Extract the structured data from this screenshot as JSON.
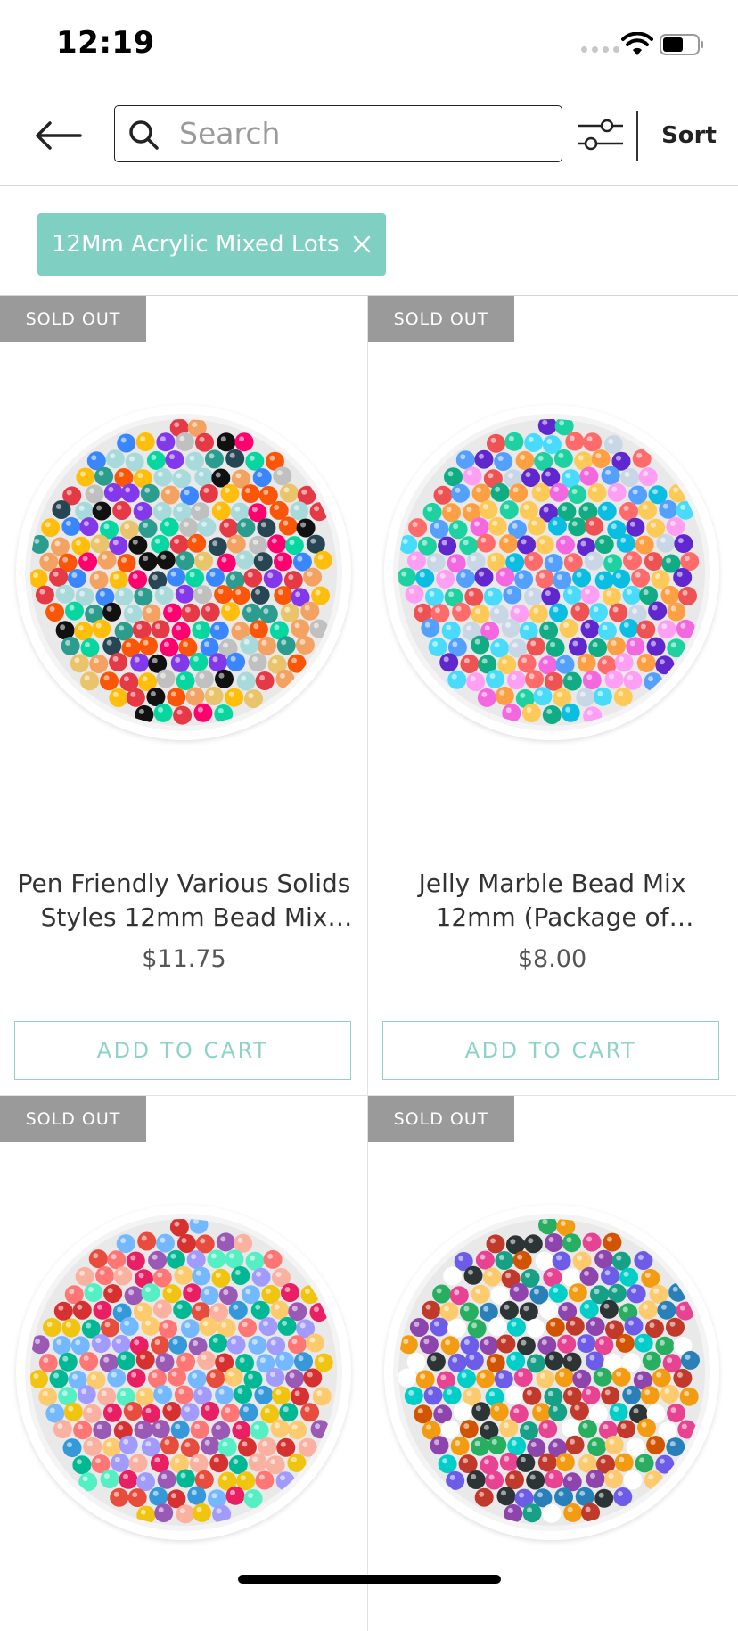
{
  "status_bar": {
    "time": "12:19"
  },
  "header": {
    "search_placeholder": "Search",
    "sort_label": "Sort"
  },
  "active_filters": [
    {
      "label": "12Mm Acrylic Mixed Lots"
    }
  ],
  "products": [
    {
      "badge": "SOLD OUT",
      "title": "Pen Friendly Various Solids Styles 12mm Bead Mix (Package of Approx...",
      "price": "$11.75",
      "cta": "ADD TO CART"
    },
    {
      "badge": "SOLD OUT",
      "title": "Jelly Marble Bead Mix 12mm (Package of Approx...",
      "price": "$8.00",
      "cta": "ADD TO CART"
    },
    {
      "badge": "SOLD OUT"
    },
    {
      "badge": "SOLD OUT"
    }
  ],
  "colors": {
    "accent": "#7fcfc2",
    "badge_bg": "#9a9a9a",
    "bead_palette_1": [
      "#e63946",
      "#f4a261",
      "#2a9d8f",
      "#264653",
      "#e9c46a",
      "#a8dadc",
      "#8338ec",
      "#ff006e",
      "#3a86ff",
      "#fb5607",
      "#c0c0c0",
      "#111111",
      "#06d6a0",
      "#ffbe0b"
    ],
    "bead_palette_2": [
      "#ff6b6b",
      "#feca57",
      "#48dbfb",
      "#ff9ff3",
      "#54a0ff",
      "#5f27cd",
      "#1dd1a1",
      "#ff9f43",
      "#c8d6e5",
      "#ee5253",
      "#0abde3",
      "#10ac84",
      "#f368e0"
    ],
    "bead_palette_3": [
      "#e74c3c",
      "#f1c40f",
      "#3498db",
      "#9b59b6",
      "#e91e63",
      "#ff7675",
      "#fdcb6e",
      "#00b894",
      "#a29bfe",
      "#d63031",
      "#fab1a0",
      "#74b9ff",
      "#55efc4"
    ],
    "bead_palette_4": [
      "#c0392b",
      "#27ae60",
      "#2980b9",
      "#8e44ad",
      "#f39c12",
      "#16a085",
      "#e84393",
      "#2d3436",
      "#ffffff",
      "#00cec9",
      "#6c5ce7",
      "#fdcb6e",
      "#d35400"
    ]
  }
}
